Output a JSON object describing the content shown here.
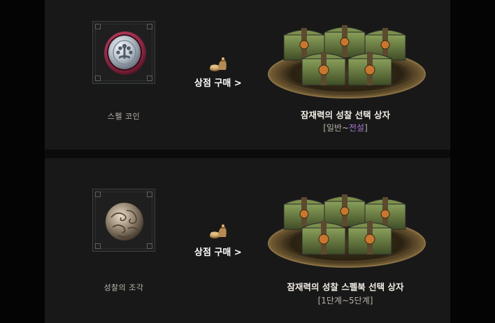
{
  "rows": [
    {
      "item_label": "스펠 코인",
      "item_icon": "spell-coin-icon",
      "shop_link": "상점 구매 >",
      "reward_title": "잠재력의 성찰 선택 상자",
      "reward_range_open": "[일반~",
      "reward_range_highlight": "전설",
      "reward_range_close": "]"
    },
    {
      "item_label": "성찰의 조각",
      "item_icon": "reflection-fragment-icon",
      "shop_link": "상점 구매 >",
      "reward_title": "잠재력의 성찰 스펠북 선택 상자",
      "reward_range": "[1단계~5단계]"
    }
  ],
  "colors": {
    "background": "#181818",
    "legendary": "#a97ad6",
    "title": "#f1ece4",
    "label": "#b9b3aa"
  }
}
